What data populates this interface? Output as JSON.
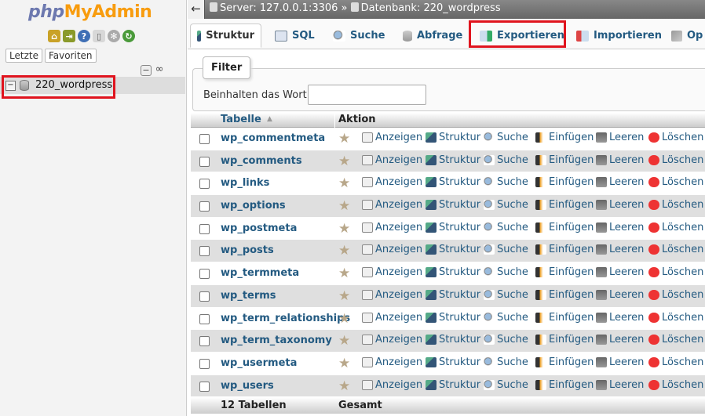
{
  "nav": {
    "logo_php": "php",
    "logo_myadmin": "MyAdmin",
    "tabs": [
      "Letzte",
      "Favoriten"
    ],
    "database": "220_wordpress",
    "icons": [
      "home-icon",
      "exit-icon",
      "help-icon",
      "docs-icon",
      "settings-icon",
      "reload-icon"
    ]
  },
  "breadcrumb": {
    "back": "←",
    "server": "Server: 127.0.0.1:3306",
    "separator": "»",
    "database": "Datenbank: 220_wordpress"
  },
  "tabs": [
    {
      "label": "Struktur",
      "icon": "structure-icon",
      "active": true
    },
    {
      "label": "SQL",
      "icon": "sql-icon"
    },
    {
      "label": "Suche",
      "icon": "search-icon"
    },
    {
      "label": "Abfrage",
      "icon": "query-icon"
    },
    {
      "label": "Exportieren",
      "icon": "export-icon"
    },
    {
      "label": "Importieren",
      "icon": "import-icon"
    },
    {
      "label": "Op",
      "icon": "operations-icon"
    }
  ],
  "filter": {
    "legend": "Filter",
    "label": "Beinhalten das Wort:",
    "value": ""
  },
  "table": {
    "col_table": "Tabelle",
    "col_action": "Aktion",
    "actions": [
      "Anzeigen",
      "Struktur",
      "Suche",
      "Einfügen",
      "Leeren",
      "Löschen"
    ],
    "rows": [
      "wp_commentmeta",
      "wp_comments",
      "wp_links",
      "wp_options",
      "wp_postmeta",
      "wp_posts",
      "wp_termmeta",
      "wp_terms",
      "wp_term_relationships",
      "wp_term_taxonomy",
      "wp_usermeta",
      "wp_users"
    ],
    "footer_count": "12 Tabellen",
    "footer_total": "Gesamt"
  },
  "colors": {
    "link": "#235a81",
    "highlight": "#e0141e",
    "logo_php": "#6c78af",
    "logo_myadmin": "#f89c0e"
  }
}
